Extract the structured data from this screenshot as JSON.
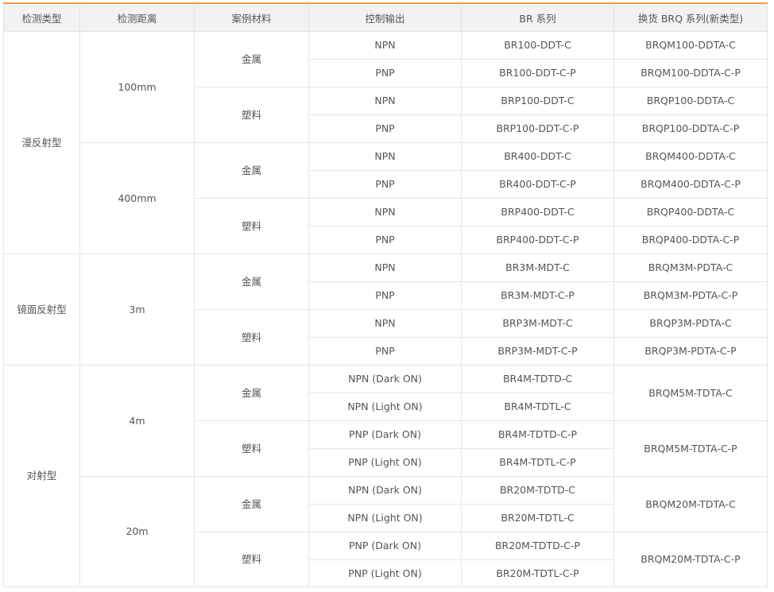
{
  "headers": [
    "检测类型",
    "检测距离",
    "案例材料",
    "控制输出",
    "BR 系列",
    "换货 BRQ 系列(新类型)"
  ],
  "types": [
    "漫反射型",
    "镜面反射型",
    "对射型"
  ],
  "distances": [
    "100mm",
    "400mm",
    "3m",
    "4m",
    "20m"
  ],
  "materials": {
    "metal": "金属",
    "plastic": "塑料"
  },
  "rows": [
    {
      "output": "NPN",
      "br": "BR100-DDT-C",
      "brq": "BRQM100-DDTA-C"
    },
    {
      "output": "PNP",
      "br": "BR100-DDT-C-P",
      "brq": "BRQM100-DDTA-C-P"
    },
    {
      "output": "NPN",
      "br": "BRP100-DDT-C",
      "brq": "BRQP100-DDTA-C"
    },
    {
      "output": "PNP",
      "br": "BRP100-DDT-C-P",
      "brq": "BRQP100-DDTA-C-P"
    },
    {
      "output": "NPN",
      "br": "BR400-DDT-C",
      "brq": "BRQM400-DDTA-C"
    },
    {
      "output": "PNP",
      "br": "BR400-DDT-C-P",
      "brq": "BRQM400-DDTA-C-P"
    },
    {
      "output": "NPN",
      "br": "BRP400-DDT-C",
      "brq": "BRQP400-DDTA-C"
    },
    {
      "output": "PNP",
      "br": "BRP400-DDT-C-P",
      "brq": "BRQP400-DDTA-C-P"
    },
    {
      "output": "NPN",
      "br": "BR3M-MDT-C",
      "brq": "BRQM3M-PDTA-C"
    },
    {
      "output": "PNP",
      "br": "BR3M-MDT-C-P",
      "brq": "BRQM3M-PDTA-C-P"
    },
    {
      "output": "NPN",
      "br": "BRP3M-MDT-C",
      "brq": "BRQP3M-PDTA-C"
    },
    {
      "output": "PNP",
      "br": "BRP3M-MDT-C-P",
      "brq": "BRQP3M-PDTA-C-P"
    },
    {
      "output": "NPN (Dark ON)",
      "br": "BR4M-TDTD-C",
      "brq": "BRQM5M-TDTA-C"
    },
    {
      "output": "NPN (Light ON)",
      "br": "BR4M-TDTL-C",
      "brq": ""
    },
    {
      "output": "PNP (Dark ON)",
      "br": "BR4M-TDTD-C-P",
      "brq": "BRQM5M-TDTA-C-P"
    },
    {
      "output": "PNP (Light ON)",
      "br": "BR4M-TDTL-C-P",
      "brq": ""
    },
    {
      "output": "NPN (Dark ON)",
      "br": "BR20M-TDTD-C",
      "brq": "BRQM20M-TDTA-C"
    },
    {
      "output": "NPN (Light ON)",
      "br": "BR20M-TDTL-C",
      "brq": ""
    },
    {
      "output": "PNP (Dark ON)",
      "br": "BR20M-TDTD-C-P",
      "brq": "BRQM20M-TDTA-C-P"
    },
    {
      "output": "PNP (Light ON)",
      "br": "BR20M-TDTL-C-P",
      "brq": ""
    }
  ]
}
